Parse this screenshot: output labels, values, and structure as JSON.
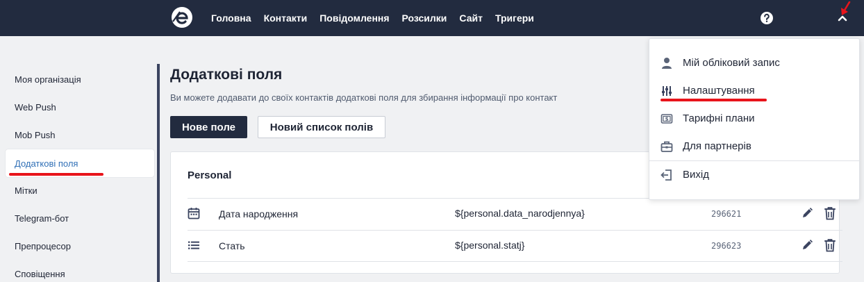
{
  "nav": {
    "items": [
      "Головна",
      "Контакти",
      "Повідомлення",
      "Розсилки",
      "Сайт",
      "Тригери"
    ]
  },
  "sidebar": {
    "items": [
      {
        "label": "Моя організація"
      },
      {
        "label": "Web Push"
      },
      {
        "label": "Mob Push"
      },
      {
        "label": "Додаткові поля",
        "active": true
      },
      {
        "label": "Мітки"
      },
      {
        "label": "Telegram-бот"
      },
      {
        "label": "Препроцесор"
      },
      {
        "label": "Сповіщення"
      }
    ]
  },
  "main": {
    "title": "Додаткові поля",
    "description": "Ви можете додавати до своїх контактів додаткові поля для збирання інформації про контакт",
    "new_field_button": "Нове поле",
    "new_list_button": "Новий список полів",
    "group": {
      "title": "Personal",
      "rows": [
        {
          "icon": "calendar-icon",
          "name": "Дата народження",
          "key": "${personal.data_narodjennya}",
          "id": "296621"
        },
        {
          "icon": "list-icon",
          "name": "Стать",
          "key": "${personal.statj}",
          "id": "296623"
        }
      ]
    }
  },
  "dropdown": {
    "items": [
      {
        "icon": "user-icon",
        "label": "Мій обліковий запис"
      },
      {
        "icon": "sliders-icon",
        "label": "Налаштування"
      },
      {
        "icon": "billing-icon",
        "label": "Тарифні плани"
      },
      {
        "icon": "briefcase-icon",
        "label": "Для партнерів"
      },
      {
        "icon": "logout-icon",
        "label": "Вихід"
      }
    ]
  },
  "colors": {
    "navbar": "#222b3f",
    "accent": "#2f6fb6",
    "annotation": "#e8141b"
  }
}
